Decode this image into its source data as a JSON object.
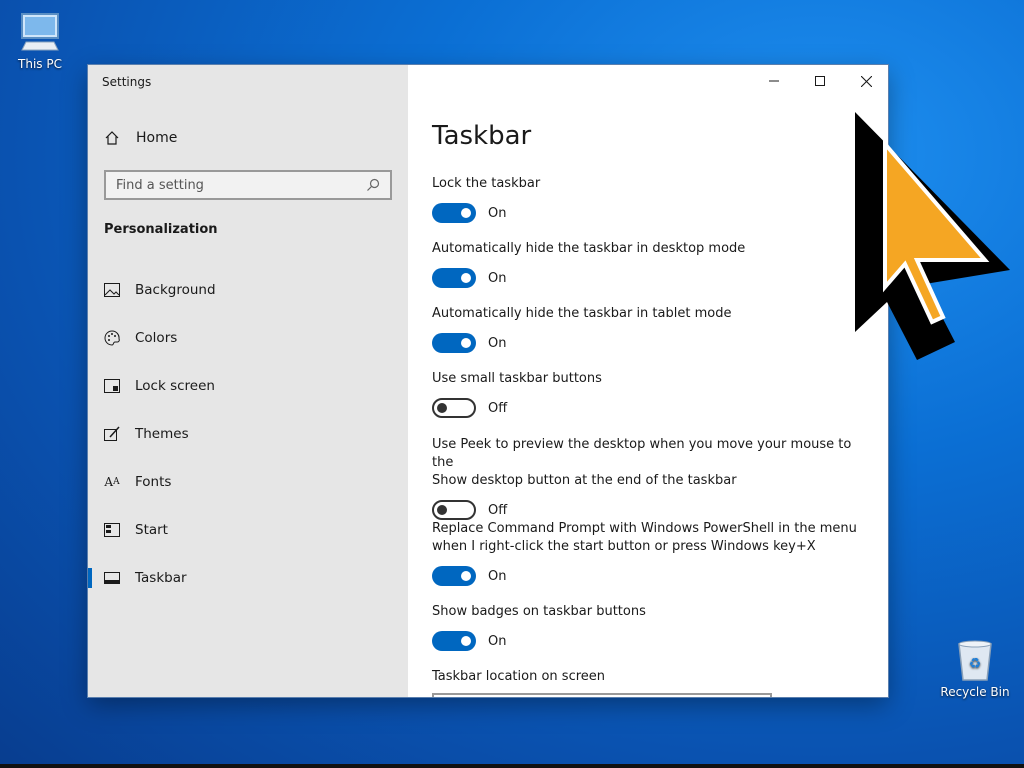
{
  "desktop": {
    "icons": [
      {
        "label": "This PC",
        "icon": "computer-icon"
      },
      {
        "label": "Recycle Bin",
        "icon": "recycle-bin-icon"
      }
    ]
  },
  "window": {
    "app_title": "Settings",
    "controls": {
      "minimize": "minimize-icon",
      "maximize": "maximize-icon",
      "close": "close-icon"
    }
  },
  "sidebar": {
    "home_label": "Home",
    "search_placeholder": "Find a setting",
    "section_title": "Personalization",
    "items": [
      {
        "label": "Background",
        "icon": "picture-icon"
      },
      {
        "label": "Colors",
        "icon": "palette-icon"
      },
      {
        "label": "Lock screen",
        "icon": "lock-screen-icon"
      },
      {
        "label": "Themes",
        "icon": "brush-icon"
      },
      {
        "label": "Fonts",
        "icon": "fonts-icon"
      },
      {
        "label": "Start",
        "icon": "start-icon"
      },
      {
        "label": "Taskbar",
        "icon": "taskbar-icon",
        "selected": true
      }
    ]
  },
  "main": {
    "title": "Taskbar",
    "settings": [
      {
        "label": "Lock the taskbar",
        "state": "On",
        "on": true
      },
      {
        "label": "Automatically hide the taskbar in desktop mode",
        "state": "On",
        "on": true
      },
      {
        "label": "Automatically hide the taskbar in tablet mode",
        "state": "On",
        "on": true
      },
      {
        "label": "Use small taskbar buttons",
        "state": "Off",
        "on": false
      },
      {
        "label_line1": "Use Peek to preview the desktop when you move your mouse to the",
        "label_line2": "Show desktop button at the end of the taskbar",
        "state": "Off",
        "on": false
      },
      {
        "label_line1": "Replace Command Prompt with Windows PowerShell in the menu",
        "label_line2": "when I right-click the start button or press Windows key+X",
        "state": "On",
        "on": true
      },
      {
        "label": "Show badges on taskbar buttons",
        "state": "On",
        "on": true
      }
    ],
    "location_label": "Taskbar location on screen"
  },
  "colors": {
    "accent": "#0067c0",
    "sidebar_bg": "#e6e6e6",
    "cursor": "#f5a623"
  }
}
